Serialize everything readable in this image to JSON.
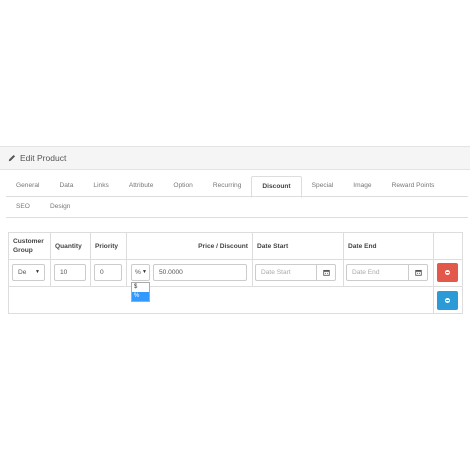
{
  "panel": {
    "title": "Edit Product"
  },
  "tabs": {
    "row1": [
      "General",
      "Data",
      "Links",
      "Attribute",
      "Option",
      "Recurring",
      "Discount",
      "Special",
      "Image",
      "Reward Points"
    ],
    "row2": [
      "SEO",
      "Design"
    ],
    "active": "Discount"
  },
  "table": {
    "headers": {
      "customer_group_line1": "Customer",
      "customer_group_line2": "Group",
      "quantity": "Quantity",
      "priority": "Priority",
      "price_discount": "Price / Discount",
      "date_start": "Date Start",
      "date_end": "Date End"
    },
    "row": {
      "customer_group": "De",
      "quantity": "10",
      "priority": "0",
      "type": "%",
      "price": "50.0000",
      "date_start_placeholder": "Date Start",
      "date_end_placeholder": "Date End"
    },
    "type_options": [
      "$",
      "%"
    ],
    "type_selected": "%"
  },
  "colors": {
    "delete_button": "#e2594b",
    "add_button": "#2b9ad6",
    "dropdown_highlight": "#3399ff"
  },
  "icons": {
    "heading": "pencil-icon",
    "date": "calendar-icon",
    "delete": "minus-circle-icon",
    "add": "plus-circle-icon"
  }
}
